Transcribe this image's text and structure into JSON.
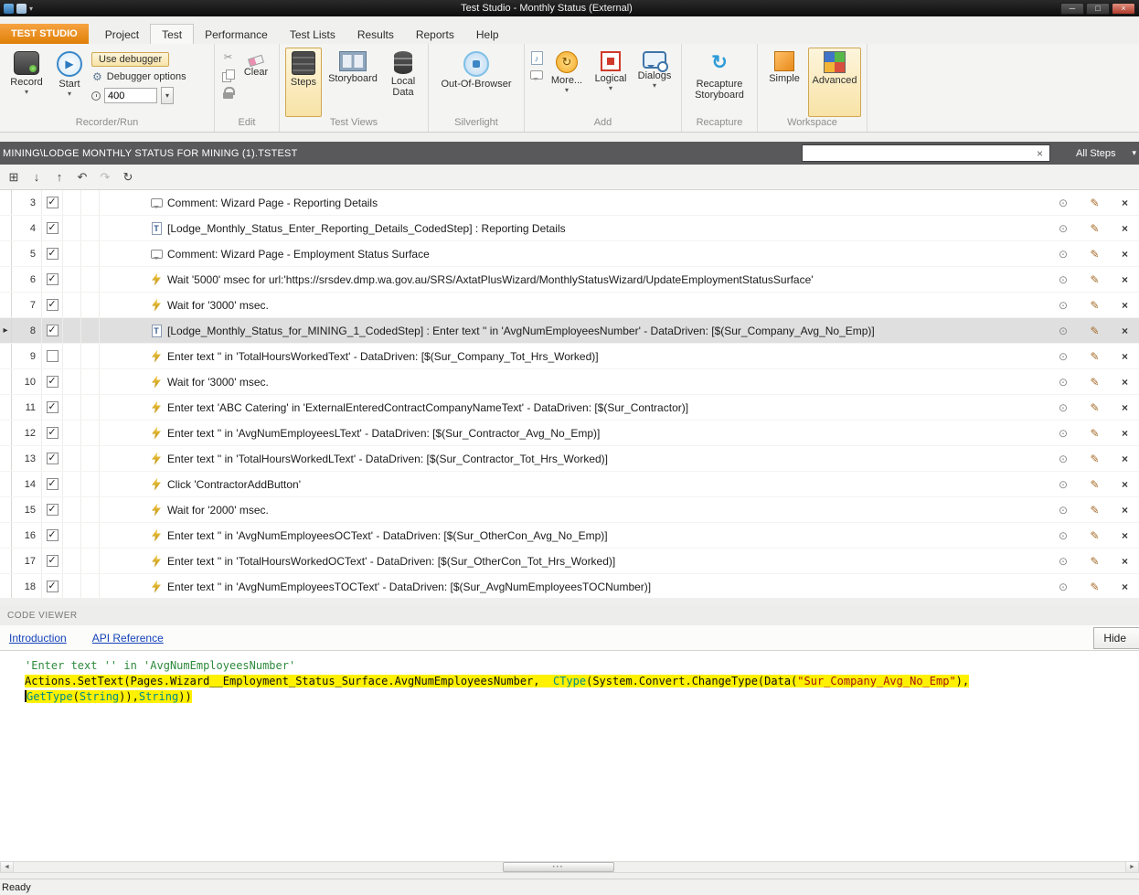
{
  "window": {
    "title": "Test Studio - Monthly Status (External)",
    "status": "Ready"
  },
  "colors": {
    "accent_orange": "#E8830C",
    "highlight_yellow": "#FFF100",
    "selected_row_gray": "#DFDFDF",
    "path_bar_gray": "#59595B"
  },
  "menu": {
    "app_tab": "TEST STUDIO",
    "tabs": [
      "Project",
      "Test",
      "Performance",
      "Test Lists",
      "Results",
      "Reports",
      "Help"
    ],
    "active_tab": "Test"
  },
  "ribbon": {
    "record": "Record",
    "start": "Start",
    "use_debugger": "Use debugger",
    "debugger_options": "Debugger options",
    "delay_value": "400",
    "clear": "Clear",
    "steps": "Steps",
    "storyboard": "Storyboard",
    "local_data": "Local Data",
    "out_of_browser": "Out-Of-Browser",
    "more": "More...",
    "logical": "Logical",
    "dialogs": "Dialogs",
    "recapture_storyboard": "Recapture Storyboard",
    "simple": "Simple",
    "advanced": "Advanced",
    "groups": [
      "Recorder/Run",
      "Edit",
      "Test Views",
      "Silverlight",
      "Add",
      "Recapture",
      "Workspace"
    ]
  },
  "test_bar": {
    "path": "MINING\\LODGE MONTHLY STATUS FOR MINING (1).TSTEST",
    "search_clear": "×",
    "filter": "All Steps"
  },
  "steps": [
    {
      "num": "3",
      "checked": true,
      "icon": "comment",
      "selected": false,
      "text": "Comment: Wizard Page - Reporting Details"
    },
    {
      "num": "4",
      "checked": true,
      "icon": "coded",
      "selected": false,
      "text": "[Lodge_Monthly_Status_Enter_Reporting_Details_CodedStep] : Reporting Details"
    },
    {
      "num": "5",
      "checked": true,
      "icon": "comment",
      "selected": false,
      "text": "Comment: Wizard Page - Employment Status Surface"
    },
    {
      "num": "6",
      "checked": true,
      "icon": "action",
      "selected": false,
      "text": "Wait '5000' msec for url:'https://srsdev.dmp.wa.gov.au/SRS/AxtatPlusWizard/MonthlyStatusWizard/UpdateEmploymentStatusSurface'"
    },
    {
      "num": "7",
      "checked": true,
      "icon": "action",
      "selected": false,
      "text": "Wait for '3000' msec."
    },
    {
      "num": "8",
      "checked": true,
      "icon": "coded",
      "selected": true,
      "text": "[Lodge_Monthly_Status_for_MINING_1_CodedStep] : Enter text '' in 'AvgNumEmployeesNumber' - DataDriven: [$(Sur_Company_Avg_No_Emp)]"
    },
    {
      "num": "9",
      "checked": false,
      "icon": "action",
      "selected": false,
      "text": "Enter text '' in 'TotalHoursWorkedText' - DataDriven: [$(Sur_Company_Tot_Hrs_Worked)]"
    },
    {
      "num": "10",
      "checked": true,
      "icon": "action",
      "selected": false,
      "text": "Wait for '3000' msec."
    },
    {
      "num": "11",
      "checked": true,
      "icon": "action",
      "selected": false,
      "text": "Enter text 'ABC Catering' in 'ExternalEnteredContractCompanyNameText' - DataDriven: [$(Sur_Contractor)]"
    },
    {
      "num": "12",
      "checked": true,
      "icon": "action",
      "selected": false,
      "text": "Enter text '' in 'AvgNumEmployeesLText' - DataDriven: [$(Sur_Contractor_Avg_No_Emp)]"
    },
    {
      "num": "13",
      "checked": true,
      "icon": "action",
      "selected": false,
      "text": "Enter text '' in 'TotalHoursWorkedLText' - DataDriven: [$(Sur_Contractor_Tot_Hrs_Worked)]"
    },
    {
      "num": "14",
      "checked": true,
      "icon": "action",
      "selected": false,
      "text": "Click 'ContractorAddButton'"
    },
    {
      "num": "15",
      "checked": true,
      "icon": "action",
      "selected": false,
      "text": "Wait for '2000' msec."
    },
    {
      "num": "16",
      "checked": true,
      "icon": "action",
      "selected": false,
      "text": "Enter text '' in 'AvgNumEmployeesOCText' - DataDriven: [$(Sur_OtherCon_Avg_No_Emp)]"
    },
    {
      "num": "17",
      "checked": true,
      "icon": "action",
      "selected": false,
      "text": "Enter text '' in 'TotalHoursWorkedOCText' - DataDriven: [$(Sur_OtherCon_Tot_Hrs_Worked)]"
    },
    {
      "num": "18",
      "checked": true,
      "icon": "action",
      "selected": false,
      "text": "Enter text '' in 'AvgNumEmployeesTOCText' - DataDriven: [$(Sur_AvgNumEmployeesTOCNumber)]"
    }
  ],
  "code_viewer": {
    "title": "CODE VIEWER",
    "links": [
      "Introduction",
      "API Reference"
    ],
    "hide_button": "Hide",
    "lines": [
      {
        "highlight": false,
        "segments": [
          {
            "t": "'Enter text '' in 'AvgNumEmployeesNumber'",
            "c": "comment"
          }
        ]
      },
      {
        "highlight": true,
        "segments": [
          {
            "t": "Actions.SetText(Pages.Wizard__Employment_Status_Surface.AvgNumEmployeesNumber,  ",
            "c": "plain"
          },
          {
            "t": "CType",
            "c": "keyword"
          },
          {
            "t": "(System.Convert.ChangeType(Data(",
            "c": "plain"
          },
          {
            "t": "\"Sur_Company_Avg_No_Emp\"",
            "c": "string"
          },
          {
            "t": "),",
            "c": "plain"
          }
        ]
      },
      {
        "highlight": true,
        "segments": [
          {
            "t": "GetType",
            "c": "keyword"
          },
          {
            "t": "(",
            "c": "plain"
          },
          {
            "t": "String",
            "c": "keyword"
          },
          {
            "t": ")),",
            "c": "plain"
          },
          {
            "t": "String",
            "c": "keyword"
          },
          {
            "t": "))",
            "c": "plain"
          }
        ]
      }
    ]
  }
}
